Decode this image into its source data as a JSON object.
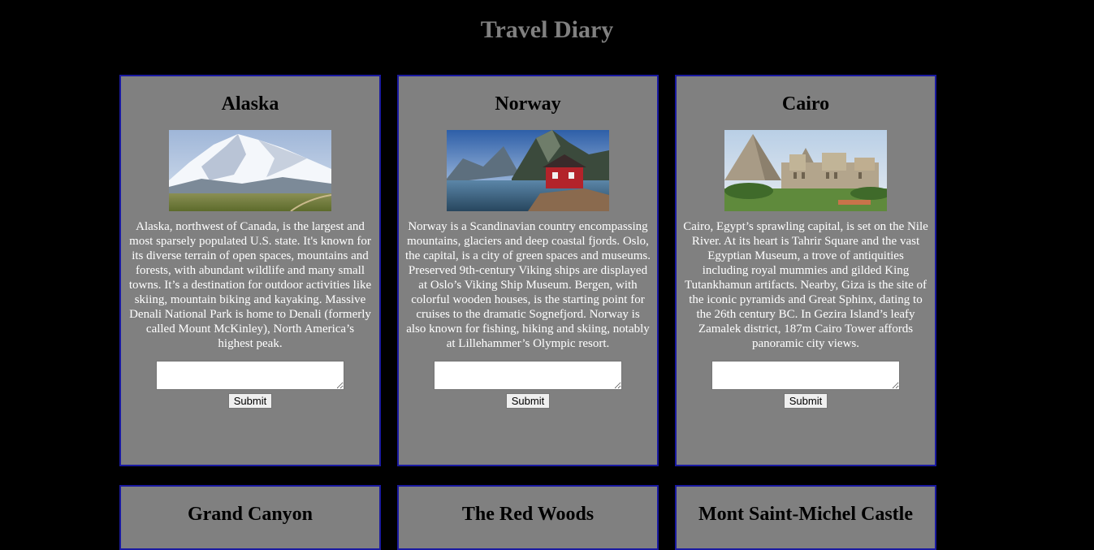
{
  "page": {
    "title": "Travel Diary"
  },
  "colors": {
    "background": "#000000",
    "card_background": "#808080",
    "card_border": "#1a1aa0",
    "title_color": "#808080",
    "card_text": "#ffffff",
    "card_heading": "#000000"
  },
  "destinations": [
    {
      "name": "Alaska",
      "image": "alaska-mountain-photo",
      "description": "Alaska, northwest of Canada, is the largest and most sparsely populated U.S. state. It's known for its diverse terrain of open spaces, mountains and forests, with abundant wildlife and many small towns. It’s a destination for outdoor activities like skiing, mountain biking and kayaking. Massive Denali National Park is home to Denali (formerly called Mount McKinley), North America’s highest peak.",
      "entry_value": "",
      "submit_label": "Submit"
    },
    {
      "name": "Norway",
      "image": "norway-fjord-photo",
      "description": "Norway is a Scandinavian country encompassing mountains, glaciers and deep coastal fjords. Oslo, the capital, is a city of green spaces and museums. Preserved 9th-century Viking ships are displayed at Oslo’s Viking Ship Museum. Bergen, with colorful wooden houses, is the starting point for cruises to the dramatic Sognefjord. Norway is also known for fishing, hiking and skiing, notably at Lillehammer’s Olympic resort.",
      "entry_value": "",
      "submit_label": "Submit"
    },
    {
      "name": "Cairo",
      "image": "cairo-pyramids-photo",
      "description": "Cairo, Egypt’s sprawling capital, is set on the Nile River. At its heart is Tahrir Square and the vast Egyptian Museum, a trove of antiquities including royal mummies and gilded King Tutankhamun artifacts. Nearby, Giza is the site of the iconic pyramids and Great Sphinx, dating to the 26th century BC. In Gezira Island’s leafy Zamalek district, 187m Cairo Tower affords panoramic city views.",
      "entry_value": "",
      "submit_label": "Submit"
    },
    {
      "name": "Grand Canyon"
    },
    {
      "name": "The Red Woods"
    },
    {
      "name": "Mont Saint-Michel Castle"
    }
  ]
}
